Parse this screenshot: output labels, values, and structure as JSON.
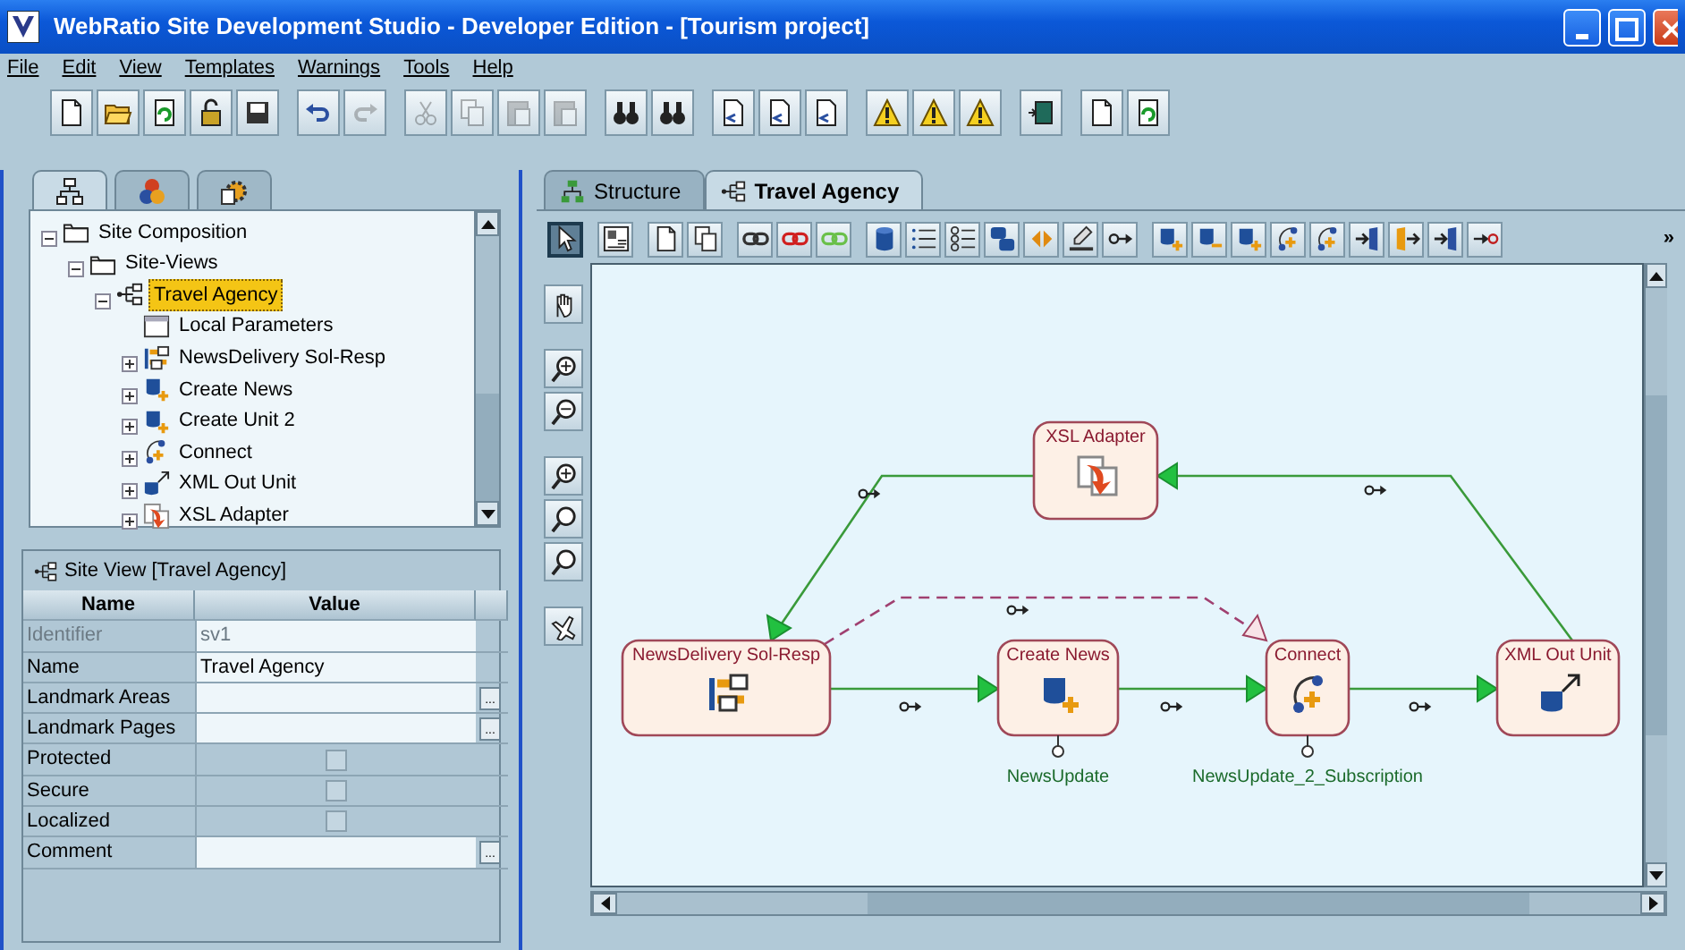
{
  "window": {
    "title": "WebRatio Site Development Studio - Developer Edition - [Tourism project]"
  },
  "menu": [
    "File",
    "Edit",
    "View",
    "Templates",
    "Warnings",
    "Tools",
    "Help"
  ],
  "toolbar": [
    [
      {
        "disabled": false
      },
      {
        "disabled": false
      },
      {
        "disabled": false
      },
      {
        "disabled": false
      },
      {
        "disabled": false
      }
    ],
    [
      {
        "disabled": false
      },
      {
        "disabled": true
      }
    ],
    [
      {
        "disabled": true
      },
      {
        "disabled": true
      },
      {
        "disabled": true
      },
      {
        "disabled": true
      }
    ],
    [
      {
        "disabled": false
      },
      {
        "disabled": false
      }
    ],
    [
      {
        "disabled": false
      },
      {
        "disabled": false
      },
      {
        "disabled": false
      }
    ],
    [
      {
        "disabled": false
      },
      {
        "disabled": false
      },
      {
        "disabled": false
      }
    ],
    [
      {
        "disabled": false
      }
    ],
    [
      {
        "disabled": false
      },
      {
        "disabled": false
      }
    ]
  ],
  "left_tabs": [
    {
      "selected": true
    },
    {
      "selected": false
    },
    {
      "selected": false
    }
  ],
  "tree": [
    {
      "label": "Site Composition",
      "kind": "folder",
      "expanded": true,
      "selected": false,
      "children": [
        {
          "label": "Site-Views",
          "kind": "folder",
          "expanded": true,
          "selected": false,
          "children": [
            {
              "label": "Travel Agency",
              "kind": "siteview",
              "expanded": true,
              "selected": true,
              "children": [
                {
                  "label": "Local Parameters",
                  "kind": "params",
                  "selected": false
                },
                {
                  "label": "NewsDelivery Sol-Resp",
                  "kind": "messaging",
                  "expanded": false,
                  "selected": false
                },
                {
                  "label": "Create News",
                  "kind": "create",
                  "expanded": false,
                  "selected": false
                },
                {
                  "label": "Create Unit 2",
                  "kind": "create",
                  "expanded": false,
                  "selected": false
                },
                {
                  "label": "Connect",
                  "kind": "connect",
                  "expanded": false,
                  "selected": false
                },
                {
                  "label": "XML Out Unit",
                  "kind": "xmlout",
                  "expanded": false,
                  "selected": false
                },
                {
                  "label": "XSL Adapter",
                  "kind": "xsl",
                  "expanded": false,
                  "selected": false
                }
              ]
            }
          ]
        }
      ]
    }
  ],
  "properties": {
    "title": "Site View [Travel Agency]",
    "columns": [
      "Name",
      "Value"
    ],
    "rows": [
      {
        "name": "Identifier",
        "kind": "text",
        "value": "sv1",
        "disabled": true
      },
      {
        "name": "Name",
        "kind": "text",
        "value": "Travel Agency",
        "disabled": false
      },
      {
        "name": "Landmark Areas",
        "kind": "picker",
        "button": "...",
        "disabled": false
      },
      {
        "name": "Landmark Pages",
        "kind": "picker",
        "button": "...",
        "disabled": false
      },
      {
        "name": "Protected",
        "kind": "checkbox",
        "checked": false,
        "disabled": false
      },
      {
        "name": "Secure",
        "kind": "checkbox",
        "checked": false,
        "disabled": false
      },
      {
        "name": "Localized",
        "kind": "checkbox",
        "checked": false,
        "disabled": false
      },
      {
        "name": "Comment",
        "kind": "picker",
        "button": "...",
        "disabled": false
      }
    ]
  },
  "editor_tabs": [
    {
      "label": "Structure",
      "selected": false
    },
    {
      "label": "Travel Agency",
      "selected": true
    }
  ],
  "palette": {
    "tools": [
      {
        "selected": true
      },
      {
        "selected": false
      },
      {
        "selected": false
      },
      {
        "selected": false
      },
      {
        "selected": false
      },
      {
        "selected": false
      },
      {
        "selected": false
      },
      {
        "selected": false
      },
      {
        "selected": false
      },
      {
        "selected": false
      },
      {
        "selected": false
      },
      {
        "selected": false
      },
      {
        "selected": false
      },
      {
        "selected": false
      },
      {
        "selected": false
      },
      {
        "selected": false
      },
      {
        "selected": false
      },
      {
        "selected": false
      },
      {
        "selected": false
      },
      {
        "selected": false
      },
      {
        "selected": false
      },
      {
        "selected": false
      },
      {
        "selected": false
      }
    ],
    "overflow": "»"
  },
  "diagram": {
    "nodes": [
      {
        "title": "XSL Adapter",
        "kind": "xsl"
      },
      {
        "title": "NewsDelivery Sol-Resp",
        "kind": "messaging"
      },
      {
        "title": "Create News",
        "kind": "create",
        "parameter": "NewsUpdate"
      },
      {
        "title": "Connect",
        "kind": "connect",
        "parameter": "NewsUpdate_2_Subscription"
      },
      {
        "title": "XML Out Unit",
        "kind": "xmlout"
      }
    ],
    "links": [
      {
        "kind": "normal"
      },
      {
        "kind": "normal"
      },
      {
        "kind": "normal"
      },
      {
        "kind": "normal"
      },
      {
        "kind": "normal"
      },
      {
        "kind": "transport"
      }
    ]
  }
}
